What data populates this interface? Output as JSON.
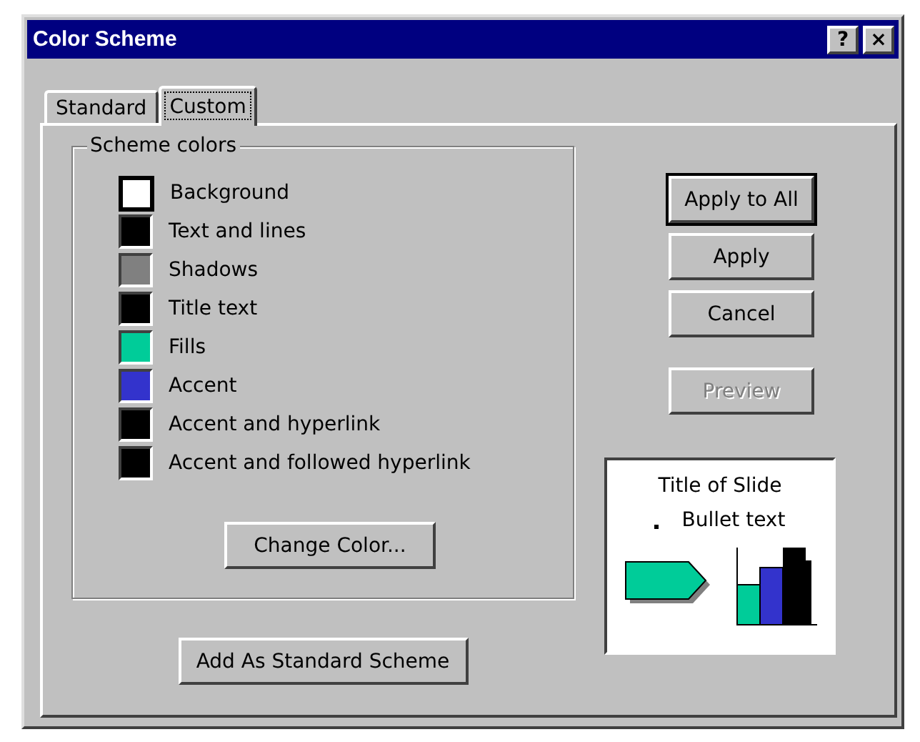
{
  "window": {
    "title": "Color Scheme",
    "controls": [
      "?",
      "×"
    ]
  },
  "tabs": [
    {
      "label": "Standard",
      "selected": false
    },
    {
      "label": "Custom",
      "selected": true
    }
  ],
  "scheme_colors": {
    "title": "Scheme colors",
    "items": [
      {
        "label": "Background",
        "color": "#ffffff",
        "selected": true
      },
      {
        "label": "Text and lines",
        "color": "#000000",
        "selected": false
      },
      {
        "label": "Shadows",
        "color": "#808080",
        "selected": false
      },
      {
        "label": "Title text",
        "color": "#000000",
        "selected": false
      },
      {
        "label": "Fills",
        "color": "#00cc99",
        "selected": false
      },
      {
        "label": "Accent",
        "color": "#3333cc",
        "selected": false
      },
      {
        "label": "Accent and hyperlink",
        "color": "#000000",
        "selected": false
      },
      {
        "label": "Accent and followed hyperlink",
        "color": "#000000",
        "selected": false
      }
    ],
    "button": "Change Color..."
  },
  "add_button": "Add As Standard Scheme",
  "buttons": [
    {
      "label": "Apply to All",
      "default": true,
      "disabled": false
    },
    {
      "label": "Apply",
      "default": false,
      "disabled": false
    },
    {
      "label": "Cancel",
      "default": false,
      "disabled": false
    },
    {
      "label": "Preview",
      "default": false,
      "disabled": true
    }
  ],
  "preview": {
    "title": "Title of Slide",
    "bullet": "Bullet text"
  }
}
